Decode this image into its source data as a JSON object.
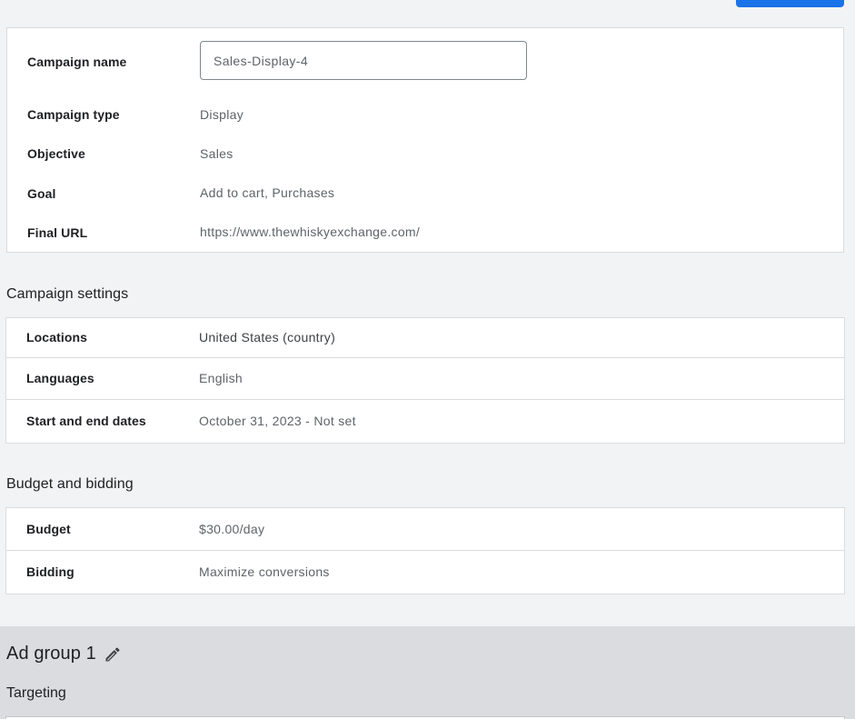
{
  "summary": {
    "campaign_name_label": "Campaign name",
    "campaign_name_value": "Sales-Display-4",
    "campaign_type_label": "Campaign type",
    "campaign_type_value": "Display",
    "objective_label": "Objective",
    "objective_value": "Sales",
    "goal_label": "Goal",
    "goal_value": "Add to cart, Purchases",
    "final_url_label": "Final URL",
    "final_url_value": "https://www.thewhiskyexchange.com/"
  },
  "campaign_settings": {
    "title": "Campaign settings",
    "rows": [
      {
        "label": "Locations",
        "value": "United States (country)"
      },
      {
        "label": "Languages",
        "value": "English"
      },
      {
        "label": "Start and end dates",
        "value": "October 31, 2023 - Not set"
      }
    ]
  },
  "budget_bidding": {
    "title": "Budget and bidding",
    "rows": [
      {
        "label": "Budget",
        "value": "$30.00/day"
      },
      {
        "label": "Bidding",
        "value": "Maximize conversions"
      }
    ]
  },
  "ad_group": {
    "title": "Ad group 1",
    "edit_icon": "pencil-icon",
    "targeting_title": "Targeting"
  },
  "colors": {
    "accent": "#1a73e8",
    "background": "#f1f3f4",
    "ad_group_band": "#dadce0"
  }
}
